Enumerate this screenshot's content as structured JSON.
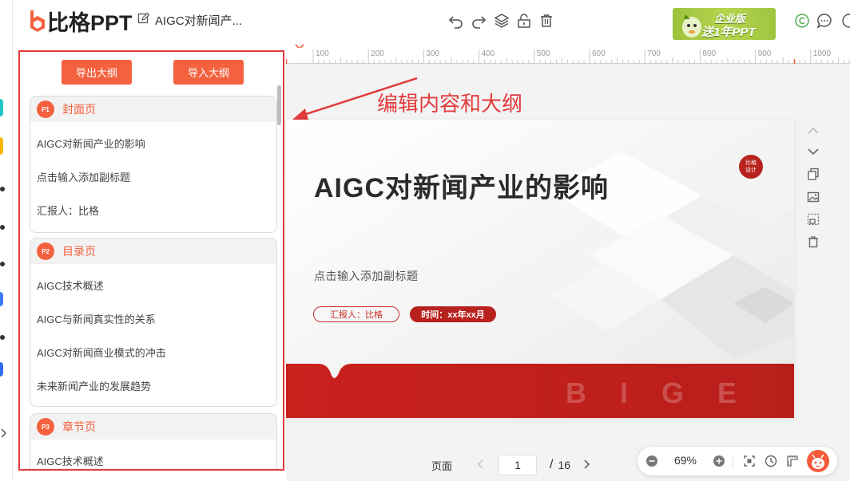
{
  "app": {
    "logo_text": "比格PPT",
    "document_title": "AIGC对新闻产..."
  },
  "promo": {
    "line1": "企业版",
    "line2": "送1年PPT"
  },
  "outline": {
    "export_label": "导出大纲",
    "import_label": "导入大纲",
    "pages": [
      {
        "badge": "P1",
        "title": "封面页",
        "items": [
          "AIGC对新闻产业的影响",
          "点击输入添加副标题",
          "汇报人：比格"
        ]
      },
      {
        "badge": "P2",
        "title": "目录页",
        "items": [
          "AIGC技术概述",
          "AIGC与新闻真实性的关系",
          "AIGC对新闻商业模式的冲击",
          "未来新闻产业的发展趋势"
        ]
      },
      {
        "badge": "P3",
        "title": "章节页",
        "items": [
          "AIGC技术概述"
        ]
      }
    ]
  },
  "ruler": {
    "labels": [
      "100",
      "200",
      "300",
      "400",
      "500",
      "600",
      "700",
      "800",
      "900",
      "1000"
    ]
  },
  "annotation": {
    "text": "编辑内容和大纲"
  },
  "slide": {
    "title": "AIGC对新闻产业的影响",
    "subtitle": "点击输入添加副标题",
    "reporter": "汇报人：比格",
    "time": "时间：xx年xx月",
    "badge_line1": "比格",
    "badge_line2": "设计",
    "watermark": "BIGE"
  },
  "pager": {
    "label": "页面",
    "current": "1",
    "separator": "/",
    "total": "16"
  },
  "zoom": {
    "value": "69%"
  },
  "colors": {
    "accent": "#f4613f",
    "highlight_border": "#e33b3b",
    "slide_red": "#b8221e"
  },
  "icons": {
    "topbar": [
      "edit-icon",
      "undo-icon",
      "redo-icon",
      "layers-icon",
      "unlock-icon",
      "delete-icon",
      "copyright-icon",
      "chat-icon"
    ],
    "right_toolbar": [
      "chevron-up-icon",
      "chevron-down-icon",
      "duplicate-icon",
      "image-icon",
      "crop-icon",
      "trash-icon"
    ]
  }
}
